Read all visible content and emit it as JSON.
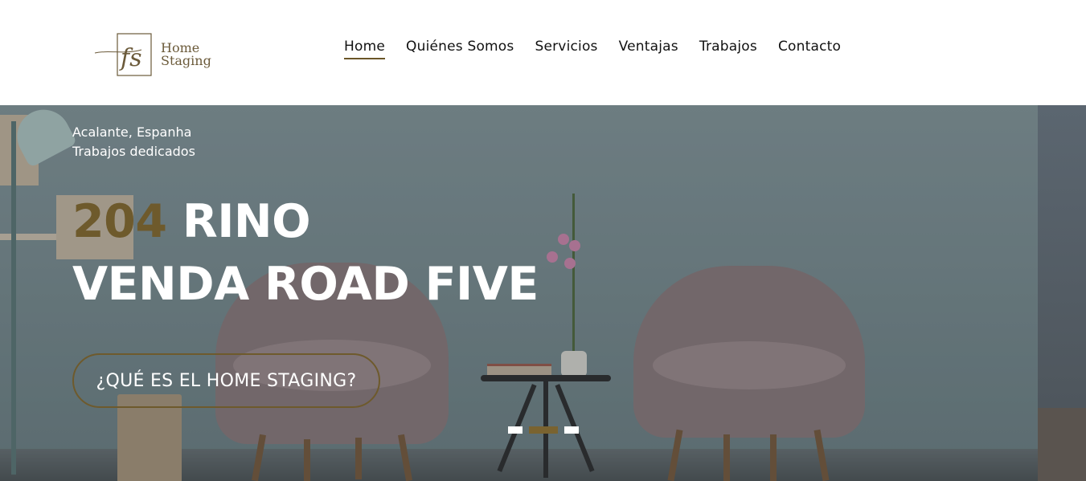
{
  "header": {
    "logo": {
      "monogram": "fs",
      "line1": "Home",
      "line2": "Staging"
    },
    "nav": [
      {
        "label": "Home",
        "active": true
      },
      {
        "label": "Quiénes Somos",
        "active": false
      },
      {
        "label": "Servicios",
        "active": false
      },
      {
        "label": "Ventajas",
        "active": false
      },
      {
        "label": "Trabajos",
        "active": false
      },
      {
        "label": "Contacto",
        "active": false
      }
    ]
  },
  "hero": {
    "subtitle_line1": "Acalante, Espanha",
    "subtitle_line2": "Trabajos dedicados",
    "title_accent": "204",
    "title_rest": " RINO",
    "title_line2": "VENDA ROAD FIVE",
    "cta_label": "¿QUÉ ES EL HOME STAGING?",
    "slides_total": 3,
    "active_slide": 2
  },
  "colors": {
    "accent": "#6e5a2c",
    "nav_text": "#111111",
    "hero_text": "#ffffff"
  }
}
